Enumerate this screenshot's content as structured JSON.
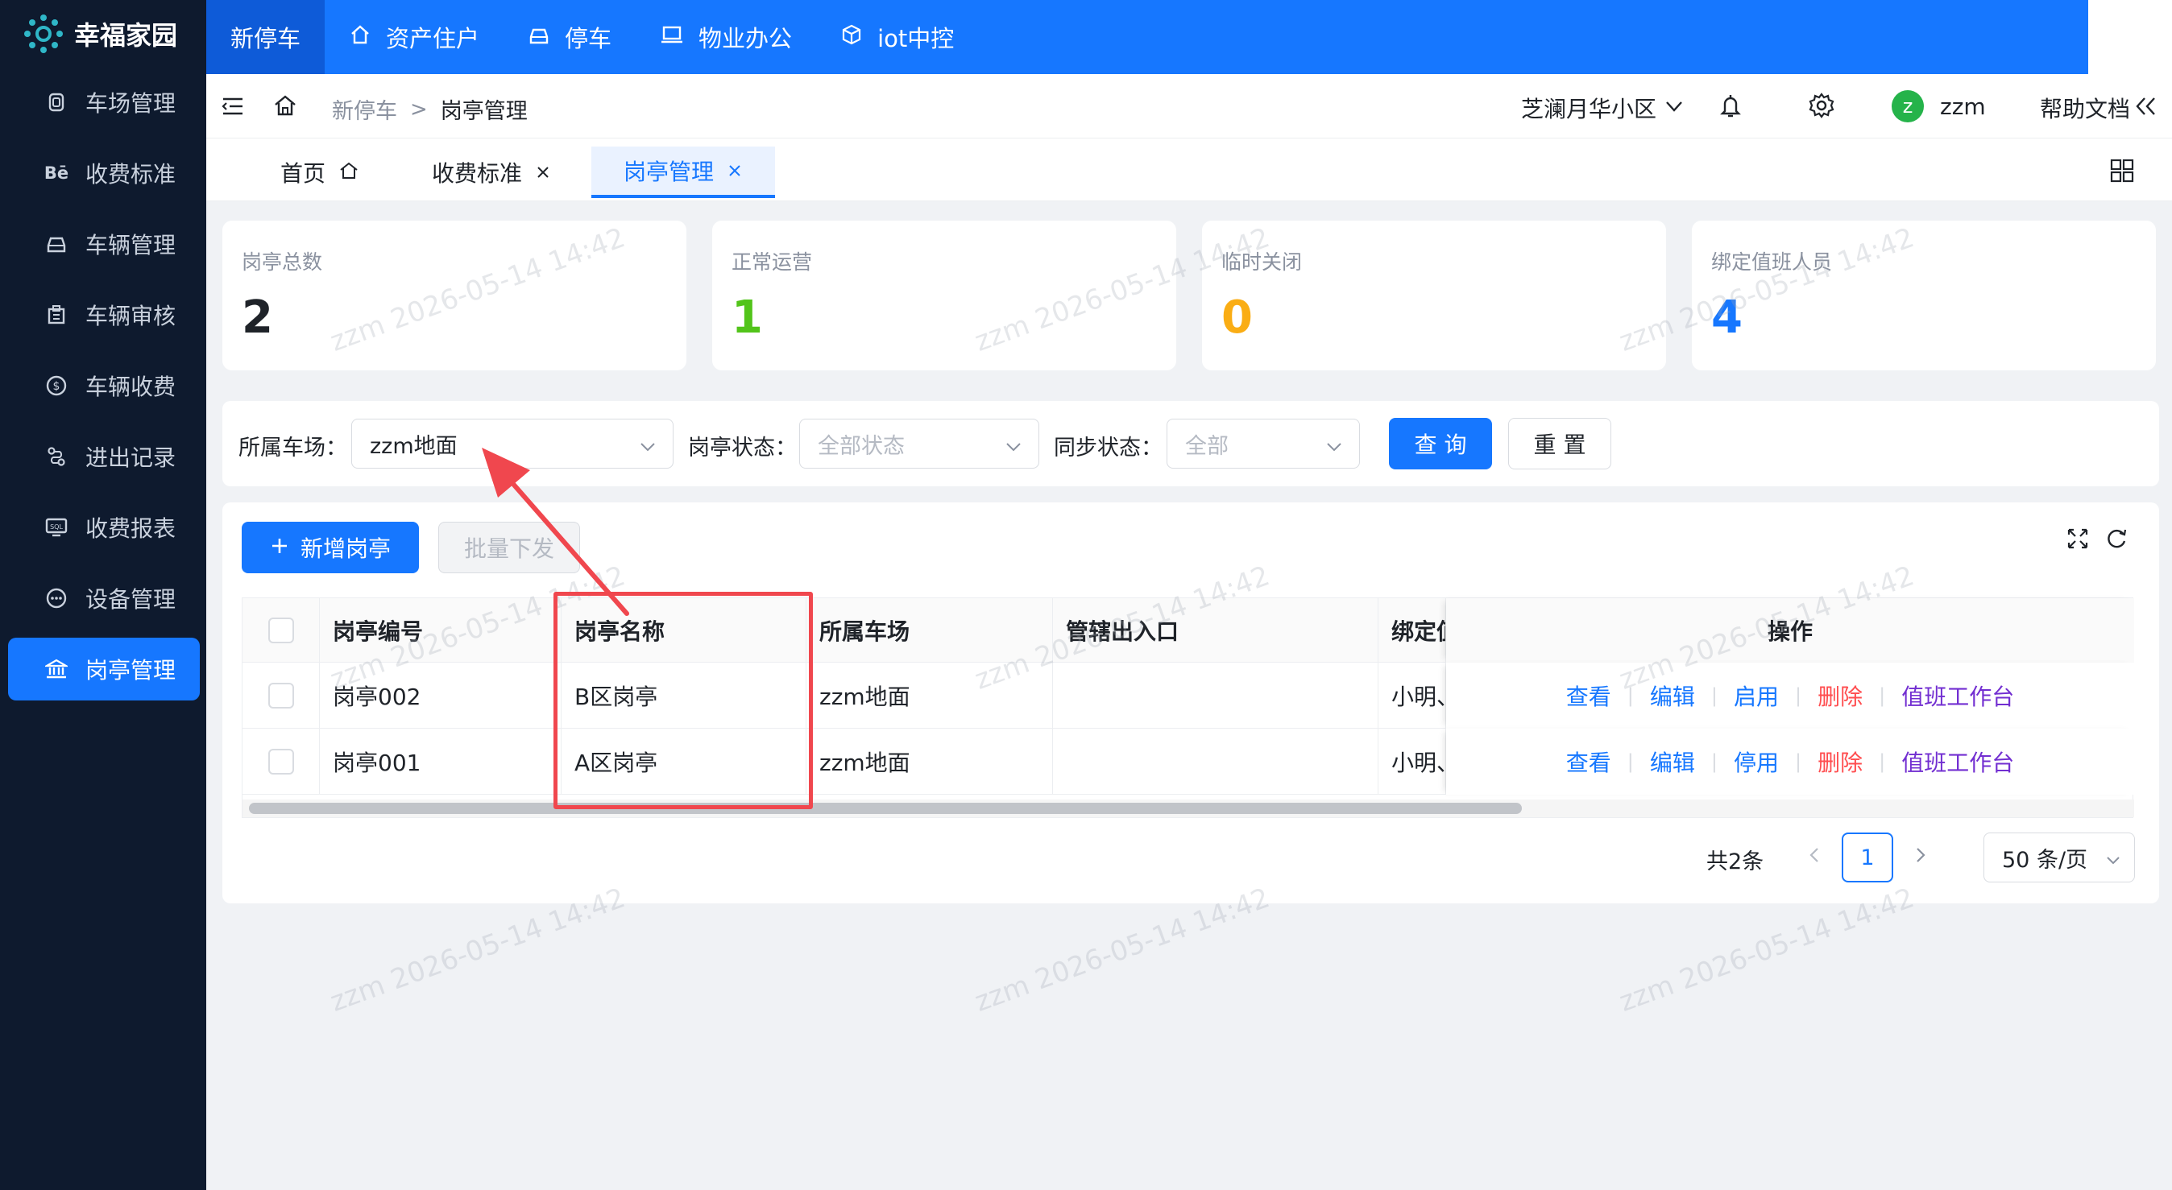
{
  "brand": {
    "name": "幸福家园"
  },
  "topnav": {
    "items": [
      {
        "label": "新停车",
        "icon": ""
      },
      {
        "label": "资产住户",
        "icon": "home-icon"
      },
      {
        "label": "停车",
        "icon": "car-icon"
      },
      {
        "label": "物业办公",
        "icon": "laptop-icon"
      },
      {
        "label": "iot中控",
        "icon": "cube-icon"
      }
    ],
    "active": "新停车",
    "color": "#1677ff"
  },
  "sidebar": {
    "items": [
      {
        "label": "车场管理",
        "icon": "parking-icon"
      },
      {
        "label": "收费标准",
        "icon": "behance-icon"
      },
      {
        "label": "车辆管理",
        "icon": "car-icon"
      },
      {
        "label": "车辆审核",
        "icon": "audit-icon"
      },
      {
        "label": "车辆收费",
        "icon": "dollar-icon"
      },
      {
        "label": "进出记录",
        "icon": "route-icon"
      },
      {
        "label": "收费报表",
        "icon": "report-icon"
      },
      {
        "label": "设备管理",
        "icon": "device-icon"
      },
      {
        "label": "岗亭管理",
        "icon": "bank-icon"
      }
    ],
    "active": "岗亭管理"
  },
  "header": {
    "breadcrumb": [
      "新停车",
      "岗亭管理"
    ],
    "breadcrumb_separator": ">",
    "community": "芝澜月华小区",
    "user": {
      "avatar": "z",
      "name": "zzm",
      "avatar_color": "#25b34a"
    },
    "help": "帮助文档"
  },
  "tabs": [
    {
      "label": "首页",
      "closable": false
    },
    {
      "label": "收费标准",
      "closable": true
    },
    {
      "label": "岗亭管理",
      "closable": true
    }
  ],
  "tabs_active": "岗亭管理",
  "stats": [
    {
      "label": "岗亭总数",
      "value": "2",
      "color": "#1f2329"
    },
    {
      "label": "正常运营",
      "value": "1",
      "color": "#52c41a"
    },
    {
      "label": "临时关闭",
      "value": "0",
      "color": "#faad14"
    },
    {
      "label": "绑定值班人员",
      "value": "4",
      "color": "#1677ff"
    }
  ],
  "filters": {
    "parking_label": "所属车场：",
    "parking_value": "zzm地面",
    "status_label": "岗亭状态：",
    "status_placeholder": "全部状态",
    "sync_label": "同步状态：",
    "sync_placeholder": "全部",
    "query_button": "查 询",
    "reset_button": "重 置"
  },
  "toolbar": {
    "add_button": "新增岗亭",
    "batch_button": "批量下发"
  },
  "table": {
    "columns": [
      "岗亭编号",
      "岗亭名称",
      "所属车场",
      "管辖出入口",
      "绑定值班人员",
      "操作"
    ],
    "columns_visible": [
      "岗亭编号",
      "岗亭名称",
      "所属车场",
      "管辖出入口",
      "绑定值",
      "操作"
    ],
    "rows": [
      {
        "code": "岗亭002",
        "name": "B区岗亭",
        "parking": "zzm地面",
        "gates": "",
        "staff": "小明、",
        "actions": [
          "查看",
          "编辑",
          "启用",
          "删除",
          "值班工作台"
        ]
      },
      {
        "code": "岗亭001",
        "name": "A区岗亭",
        "parking": "zzm地面",
        "gates": "",
        "staff": "小明、",
        "actions": [
          "查看",
          "编辑",
          "停用",
          "删除",
          "值班工作台"
        ]
      }
    ]
  },
  "pagination": {
    "total": "共2条",
    "current_page": "1",
    "page_size": "50 条/页"
  },
  "watermark": "zzm 2026-05-14 14:42"
}
